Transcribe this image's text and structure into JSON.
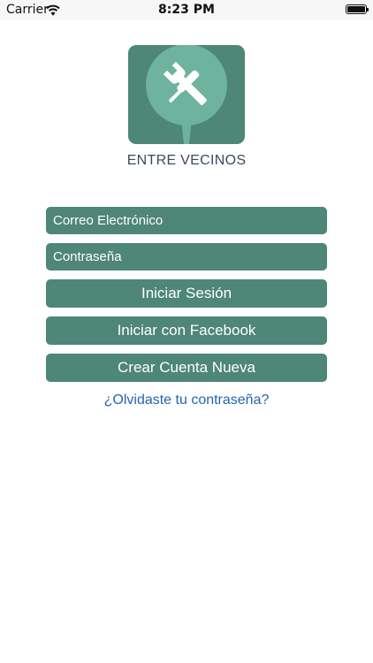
{
  "status_bar": {
    "carrier": "Carrier",
    "time": "8:23 PM",
    "battery_level": 1.0
  },
  "logo": {
    "icon": "wrench-screwdriver-icon",
    "colors": {
      "background": "#4e8677",
      "circle": "#6db39d",
      "tools": "#ffffff"
    }
  },
  "app_title": "ENTRE VECINOS",
  "form": {
    "email_placeholder": "Correo Electrónico",
    "password_placeholder": "Contraseña"
  },
  "buttons": {
    "login": "Iniciar Sesión",
    "facebook": "Iniciar con Facebook",
    "create_account": "Crear Cuenta Nueva"
  },
  "forgot_password": "¿Olvidaste tu contraseña?",
  "colors": {
    "accent": "#4e8677",
    "link": "#1f66b3",
    "title": "#3a4a64"
  }
}
